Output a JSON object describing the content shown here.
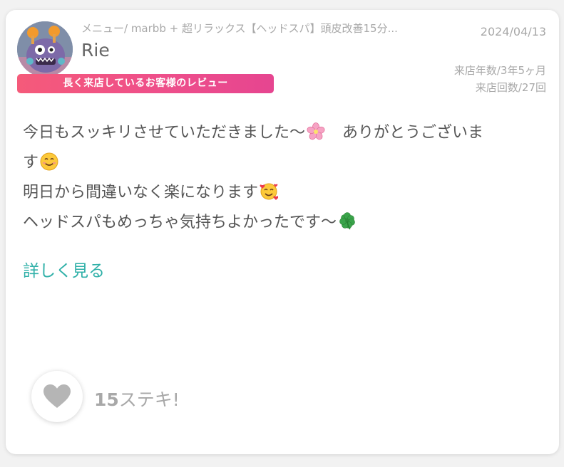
{
  "review": {
    "menu": "メニュー/ marbb + 超リラックス【ヘッドスパ】頭皮改善15分...",
    "user_name": "Rie",
    "date": "2024/04/13",
    "badge": "長く来店しているお客様のレビュー",
    "visit_years": "来店年数/3年5ヶ月",
    "visit_count": "来店回数/27回",
    "body": {
      "line1_a": "今日もスッキリさせていただきました〜",
      "line1_b": "　ありがとうございま",
      "line2": "す",
      "line3": "明日から間違いなく楽になります",
      "line4": "ヘッドスパもめっちゃ気持ちよかったです〜"
    },
    "more_link": "詳しく見る",
    "likes": {
      "count": "15",
      "label": "ステキ!"
    }
  },
  "icons": {
    "avatar": "monster-plush-avatar",
    "emoji_1": "cherry-blossom-icon",
    "emoji_2": "smiling-face-icon",
    "emoji_3": "smiling-face-with-hearts-icon",
    "emoji_4": "four-leaf-clover-icon",
    "like": "heart-icon"
  },
  "colors": {
    "badge_start": "#f55a7a",
    "badge_end": "#e64590",
    "link": "#2fb0a8",
    "heart": "#b5b5b5"
  }
}
